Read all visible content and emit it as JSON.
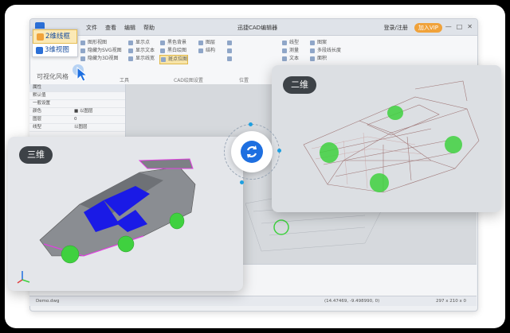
{
  "app": {
    "title": "迅捷CAD编辑器",
    "menu": [
      "文件",
      "查看",
      "编辑",
      "帮助"
    ],
    "account": {
      "login": "登录/注册",
      "vip": "加入VIP"
    }
  },
  "ribbon": {
    "groups": [
      {
        "name": "工具",
        "items": [
          "图形视图",
          "隐藏为SVG视图",
          "隐藏为3D视图"
        ]
      },
      {
        "name": "",
        "items": [
          "显示点",
          "显示文本",
          "显示线宽"
        ]
      },
      {
        "name": "CAD绘图设置",
        "items": [
          "黑色背景",
          "黑白绘图",
          "斑点位图"
        ]
      },
      {
        "name": "",
        "items": [
          "图层",
          "结构"
        ]
      },
      {
        "name": "位置",
        "items": [
          "",
          "",
          ""
        ]
      },
      {
        "name": "",
        "items": [
          "线型",
          "测量",
          "文本"
        ]
      },
      {
        "name": "",
        "items": [
          "图案",
          "多段线长度",
          "面积"
        ]
      }
    ]
  },
  "view_menu": {
    "options": [
      {
        "label": "2维线框",
        "selected": true
      },
      {
        "label": "3维视图",
        "selected": false
      }
    ],
    "group_label": "可视化风格"
  },
  "properties": {
    "header": "属性",
    "filter": "默认值",
    "section": "一般设置",
    "rows": [
      {
        "key": "颜色",
        "value": "■ 以图层"
      },
      {
        "key": "图层",
        "value": "0"
      },
      {
        "key": "线型",
        "value": "以图层"
      }
    ]
  },
  "status": {
    "file": "Demo.dwg",
    "coords": "(14.47469, -9.498990, 0)",
    "size": "297 x 210 x 0"
  },
  "panels": {
    "view2d_label": "二维",
    "view3d_label": "三维"
  },
  "colors": {
    "accent": "#1e6fe0",
    "vip": "#f0a23a",
    "car_gray": "#8a8d92",
    "glass_blue": "#1a1ae6",
    "wheel_green": "#3fd13f",
    "magenta": "#e040e0"
  },
  "icons": {
    "sync": "sync-icon",
    "cursor": "pointer-cursor-icon",
    "axis": "axis-gizmo-icon"
  }
}
